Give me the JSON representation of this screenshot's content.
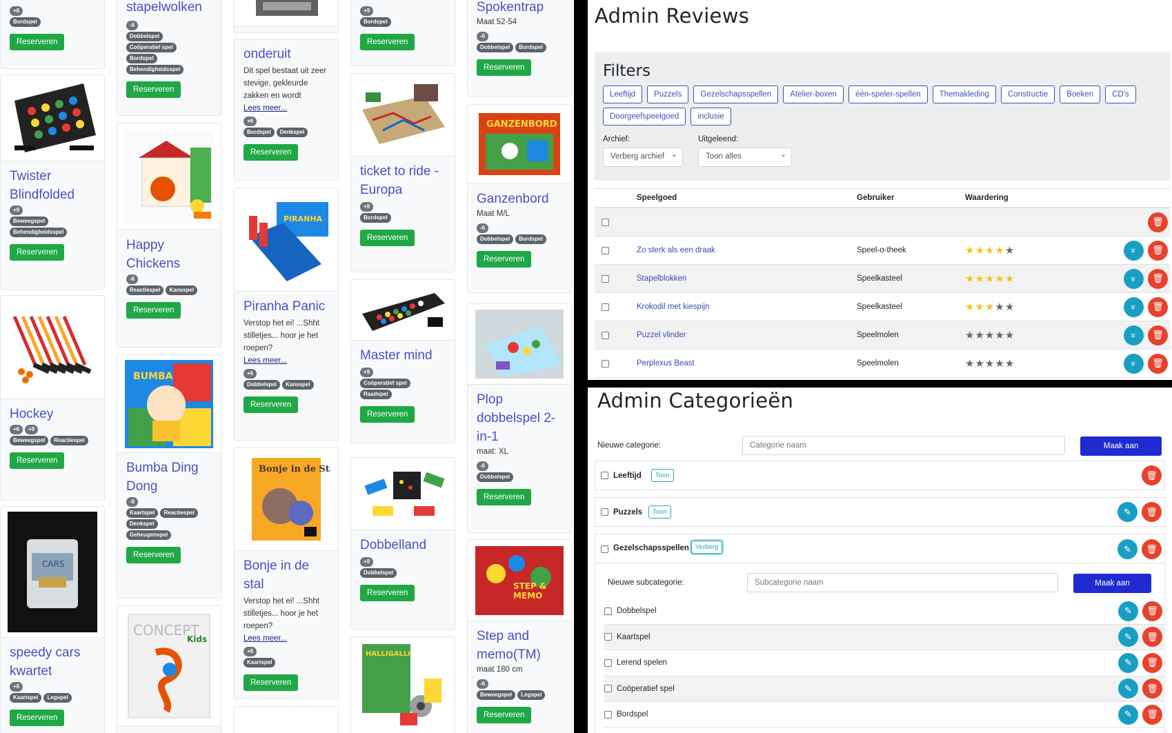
{
  "catalog": {
    "reserve_label": "Reserveren",
    "read_more": "Lees meer...",
    "columns": [
      [
        {
          "title": "",
          "age": "+6",
          "tags": [
            "Bordspel"
          ]
        },
        {
          "title": "Twister Blindfolded",
          "age": "+9",
          "tags": [
            "Beweegspel",
            "Behendigheidsspel"
          ],
          "image": "twister"
        },
        {
          "title": "Hockey",
          "age": "+6",
          "age2": "+9",
          "tags": [
            "Beweegspel",
            "Reactiespel"
          ],
          "image": "hockey"
        },
        {
          "title": "speedy cars kwartet",
          "age": "+6",
          "tags": [
            "Kaartspel",
            "Legspel"
          ],
          "image": "cars"
        }
      ],
      [
        {
          "title": "stapelwolken",
          "age": "-6",
          "tags": [
            "Dobbelspel",
            "Coöperatief spel",
            "Bordspel",
            "Behendigheidsspel"
          ]
        },
        {
          "title": "Happy Chickens",
          "age": "-6",
          "tags": [
            "Reactiespel",
            "Kansspel"
          ],
          "image": "chickens"
        },
        {
          "title": "Bumba Ding Dong",
          "age": "-6",
          "tags": [
            "Kaartspel",
            "Reactiespel",
            "Denkspel",
            "Geheugenspel"
          ],
          "image": "bumba"
        },
        {
          "title": "",
          "image": "concept"
        }
      ],
      [
        {
          "title": "onderuit",
          "desc": "Dit spel bestaat uit zeer stevige, gekleurde zakken en wordt",
          "age": "+6",
          "tags": [
            "Bordspel",
            "Denkspel"
          ]
        },
        {
          "title": "Piranha Panic",
          "desc": "Verstop het ei! ...Shht stilletjes... hoor je het roepen?",
          "age": "+6",
          "tags": [
            "Dobbelspel",
            "Kansspel"
          ],
          "image": "piranha"
        },
        {
          "title": "Bonje in de stal",
          "desc": "Verstop het ei! ...Shht stilletjes... hoor je het roepen?",
          "age": "+6",
          "tags": [
            "Kaartspel"
          ],
          "image": "bonje"
        }
      ],
      [
        {
          "title": "",
          "age": "+9",
          "tags": [
            "Bordspel"
          ]
        },
        {
          "title": "ticket to ride - Europa",
          "age": "+9",
          "tags": [
            "Bordspel"
          ],
          "image": "ticket"
        },
        {
          "title": "Master mind",
          "age": "+9",
          "tags": [
            "Coöperatief spel",
            "Raadspel"
          ],
          "image": "mastermind"
        },
        {
          "title": "Dobbelland",
          "age": "+9",
          "tags": [
            "Dobbelspel"
          ],
          "image": "dobbelland"
        },
        {
          "title": "",
          "image": "halligalli"
        }
      ],
      [
        {
          "title": "Spokentrap",
          "sub": "Maat 52-54",
          "age": "-6",
          "tags": [
            "Dobbelspel",
            "Bordspel"
          ]
        },
        {
          "title": "Ganzenbord",
          "sub": "Maat M/L",
          "age": "-6",
          "tags": [
            "Dobbelspel",
            "Bordspel"
          ],
          "image": "ganzenbord"
        },
        {
          "title": "Plop dobbelspel 2-in-1",
          "sub": "maat: XL",
          "age": "-6",
          "tags": [
            "Dobbelspel"
          ],
          "image": "plop"
        },
        {
          "title": "Step and memo(TM)",
          "sub": "maat 180 cm",
          "age": "-6",
          "tags": [
            "Beweegspel",
            "Legspel"
          ],
          "image": "stepmemo"
        }
      ]
    ]
  },
  "reviews": {
    "title": "Admin Reviews",
    "filters_title": "Filters",
    "filter_buttons": [
      "Leeftijd",
      "Puzzels",
      "Gezelschapsspellen",
      "Atelier-boxen",
      "één-speler-spellen",
      "Themakleding",
      "Constructie",
      "Boeken",
      "CD's",
      "Doorgeefspeelgoed",
      "inclusie"
    ],
    "archive_label": "Archief:",
    "archive_value": "Verberg archief",
    "lent_label": "Uitgeleend:",
    "lent_value": "Toon alles",
    "headers": {
      "toy": "Speelgoed",
      "user": "Gebruiker",
      "rating": "Waardering"
    },
    "rows": [
      {
        "toy": "Zo sterk als een draak",
        "user": "Speel-o-theek",
        "rating": 4
      },
      {
        "toy": "Stapelblokken",
        "user": "Speelkasteel",
        "rating": 5
      },
      {
        "toy": "Krokodil met kiespijn",
        "user": "Speelkasteel",
        "rating": 3
      },
      {
        "toy": "Puzzel vlinder",
        "user": "Speelmolen",
        "rating": 0
      },
      {
        "toy": "Perplexus Beast",
        "user": "Speelmolen",
        "rating": 0
      }
    ]
  },
  "categories": {
    "title": "Admin Categorieën",
    "new_label": "Nieuwe categorie:",
    "new_placeholder": "Categorie naam",
    "create_label": "Maak aan",
    "show_label": "Toon",
    "hide_label": "Verberg",
    "items": [
      "Leeftijd",
      "Puzzels",
      "Gezelschapsspellen"
    ],
    "new_sub_label": "Nieuwe subcategorie:",
    "sub_placeholder": "Subcategorie naam",
    "subitems": [
      "Dobbelspel",
      "Kaartspel",
      "Lerend spelen",
      "Coöperatief spel",
      "Bordspel"
    ]
  },
  "colors": {
    "accent": "#4a4fc6",
    "success": "#1fa845",
    "danger": "#e8412c",
    "info": "#1a9fc4",
    "primary": "#1e2bd0"
  }
}
